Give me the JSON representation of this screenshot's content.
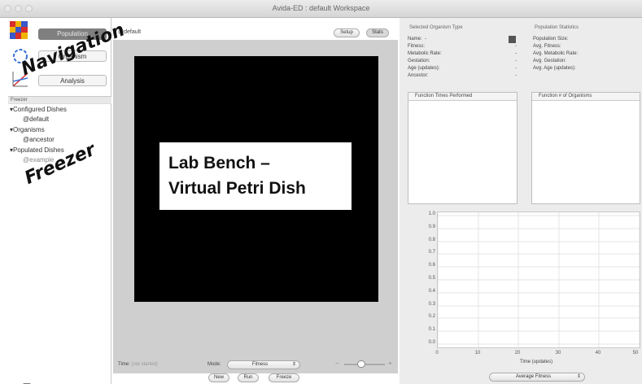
{
  "window": {
    "title": "Avida-ED : default Workspace"
  },
  "nav": {
    "population_label": "Population",
    "organism_label": "Organism",
    "analysis_label": "Analysis"
  },
  "freezer": {
    "header": "Freezer",
    "configured_dishes": "Configured Dishes",
    "default_dish": "@default",
    "organisms": "Organisms",
    "ancestor": "@ancestor",
    "populated_dishes": "Populated Dishes",
    "example": "@example"
  },
  "bench": {
    "dish_name": "@default",
    "setup_label": "Setup",
    "stats_label": "Stats",
    "time_label": "Time:",
    "time_value": "(not started)",
    "mode_label": "Mode:",
    "mode_value": "Fitness",
    "new_label": "New",
    "run_label": "Run",
    "freeze_label": "Freeze"
  },
  "organism_type": {
    "header": "Selected Organism Type",
    "name_label": "Name:",
    "name_value": "-",
    "fields": [
      "Fitness:",
      "Metabolic Rate:",
      "Gestation:",
      "Age (updates):",
      "Ancestor:"
    ],
    "values": [
      "-",
      "-",
      "-",
      "-",
      "-"
    ],
    "table_header": "Function   Times Performed"
  },
  "population_stats": {
    "header": "Population Statistics",
    "fields": [
      "Population Size:",
      "Avg. Fitness:",
      "Avg. Metabolic Rate:",
      "Avg. Gestation:",
      "Avg. Age (updates):"
    ],
    "table_header": "Function   # of Organisms"
  },
  "graph": {
    "y_ticks": [
      "1.0",
      "0.9",
      "0.8",
      "0.7",
      "0.6",
      "0.5",
      "0.4",
      "0.3",
      "0.2",
      "0.1",
      "0.0"
    ],
    "x_ticks": [
      "0",
      "10",
      "20",
      "30",
      "40",
      "50"
    ],
    "xlabel": "Time (updates)",
    "y_select_value": "Average Fitness"
  },
  "annotations": {
    "navigation": "Navigation",
    "freezer": "Freezer",
    "lab_bench_line1": "Lab Bench –",
    "lab_bench_line2": "Virtual Petri Dish"
  },
  "colors": {
    "nav_selected": "#7f7f7f",
    "dish_black": "#000000",
    "bench_gray": "#cfcfcf"
  }
}
